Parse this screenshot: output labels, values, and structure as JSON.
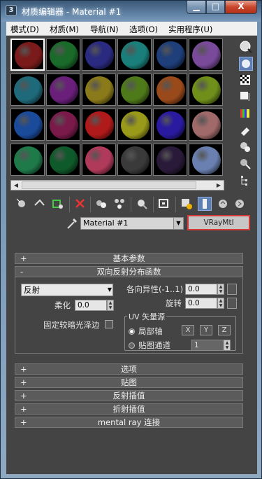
{
  "window": {
    "title": "材质编辑器 - Material #1",
    "app_icon": "3",
    "minimize": "▁",
    "maximize": "□",
    "close": "X"
  },
  "menu": [
    "模式(D)",
    "材质(M)",
    "导航(N)",
    "选项(O)",
    "实用程序(U)"
  ],
  "slots": [
    {
      "color": "#7a1a1a"
    },
    {
      "color": "#1a6a2a"
    },
    {
      "color": "#2a2a80"
    },
    {
      "color": "#1a7f7a"
    },
    {
      "color": "#1f3f7a"
    },
    {
      "color": "#7a4a9a"
    },
    {
      "color": "#1f6a7a"
    },
    {
      "color": "#6a1f7a"
    },
    {
      "color": "#8a7a1a"
    },
    {
      "color": "#4f7a1a"
    },
    {
      "color": "#9a4a1a"
    },
    {
      "color": "#6f8f1a"
    },
    {
      "color": "#1a4a9a"
    },
    {
      "color": "#7a1a4a"
    },
    {
      "color": "#b01a1a"
    },
    {
      "color": "#9a9a1a"
    },
    {
      "color": "#2a1aa0"
    },
    {
      "color": "#a06a6a"
    },
    {
      "color": "#1f7a4a"
    },
    {
      "color": "#0f5a2a"
    },
    {
      "color": "#b03a5a"
    },
    {
      "color": "#3a3a3a"
    },
    {
      "color": "#2a1a3a"
    },
    {
      "color": "#6a80b0"
    }
  ],
  "right_tools": [
    "sample-type-icon",
    "backlight-icon",
    "checker-background-icon",
    "sample-uv-tiling-icon",
    "video-color-check-icon",
    "make-preview-icon",
    "options-icon",
    "select-by-material-icon",
    "material-navigator-icon"
  ],
  "bottom_tools": [
    "get-material-icon",
    "put-to-scene-icon",
    "assign-to-selection-icon",
    "reset-map-icon",
    "copy-material-icon",
    "make-unique-icon",
    "put-to-library-icon",
    "material-id-channel-icon",
    "show-map-icon",
    "show-end-result-icon",
    "go-to-parent-icon",
    "go-forward-sibling-icon"
  ],
  "name_row": {
    "material_name": "Material #1",
    "material_type": "VRayMtl"
  },
  "rollouts": {
    "basic_params": {
      "sign": "+",
      "label": "基本参数"
    },
    "brdf": {
      "sign": "-",
      "label": "双向反射分布函数"
    },
    "options": {
      "sign": "+",
      "label": "选项"
    },
    "maps": {
      "sign": "+",
      "label": "贴图"
    },
    "refl_interp": {
      "sign": "+",
      "label": "反射插值"
    },
    "refr_interp": {
      "sign": "+",
      "label": "折射插值"
    },
    "mental_ray": {
      "sign": "+",
      "label": "mental ray 连接"
    }
  },
  "brdf": {
    "type": "反射",
    "anisotropy_label": "各向异性(-1..1)",
    "anisotropy_value": "0.0",
    "rotation_label": "旋转",
    "rotation_value": "0.0",
    "soften_label": "柔化",
    "soften_value": "0.0",
    "fix_dark_label": "固定较暗光泽边",
    "uv_group_title": "UV 矢量源",
    "local_axis_label": "局部轴",
    "map_channel_label": "贴图通道",
    "map_channel_value": "1",
    "axis_x": "X",
    "axis_y": "Y",
    "axis_z": "Z"
  }
}
